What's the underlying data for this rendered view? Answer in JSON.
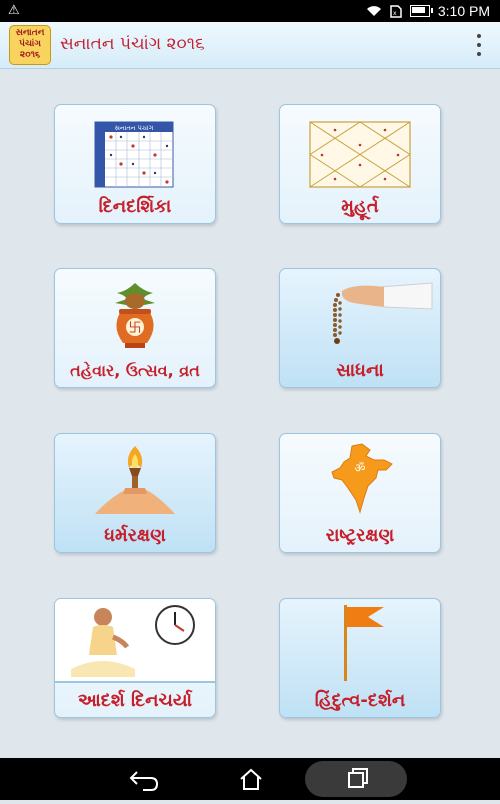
{
  "status_bar": {
    "time": "3:10 PM",
    "warning_icon": "⚠"
  },
  "app_bar": {
    "logo_line1": "સનાતન",
    "logo_line2": "પંચાંગ",
    "logo_line3": "૨૦૧૬",
    "title": "સનાતન પંચાંગ ૨૦૧૬"
  },
  "tiles": [
    {
      "label": "દિનદર્શિકા",
      "icon": "calendar-icon"
    },
    {
      "label": "મુહૂર્ત",
      "icon": "horoscope-chart-icon"
    },
    {
      "label": "તહેવાર, ઉત્સવ, વ્રત",
      "icon": "kalash-icon"
    },
    {
      "label": "સાધના",
      "icon": "rosary-hand-icon"
    },
    {
      "label": "ધર્મરક્ષણ",
      "icon": "torch-icon"
    },
    {
      "label": "રાષ્ટ્રરક્ષણ",
      "icon": "india-map-icon"
    },
    {
      "label": "આદર્શ દિનચર્યા",
      "icon": "meditating-man-clock-icon"
    },
    {
      "label": "હિંદુત્વ-દર્શન",
      "icon": "saffron-flag-icon"
    }
  ],
  "calendar_art": {
    "header": "સનાતન પંચાંગ"
  },
  "map_art": {
    "symbol": "ॐ"
  },
  "colors": {
    "label_red": "#c61f2b",
    "tile_border": "#9cc5e1",
    "app_bar_bg": "#d6ecf9"
  }
}
